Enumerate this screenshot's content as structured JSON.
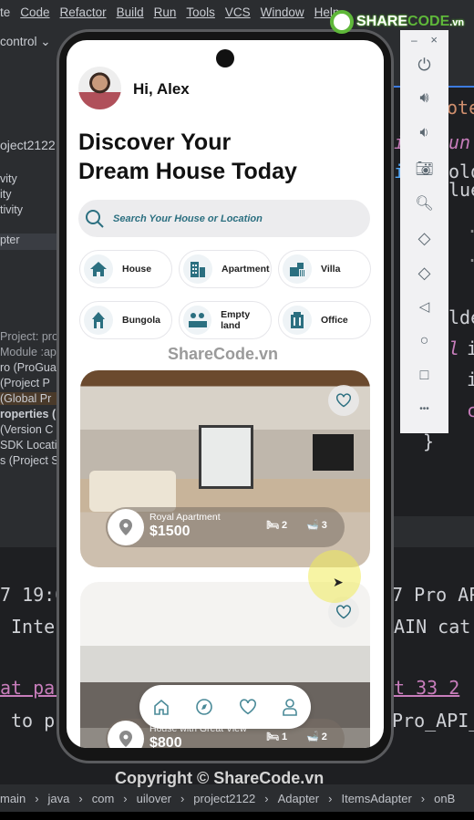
{
  "ide": {
    "menu": [
      "te",
      "Code",
      "Refactor",
      "Build",
      "Run",
      "Tools",
      "VCS",
      "Window",
      "Help"
    ],
    "run_config": "control",
    "tab_fragment": "t",
    "left_panel": [
      "oject2122",
      "vity",
      "ity",
      "tivity",
      "pter",
      "Project: pro",
      "Module :ap",
      "ro (ProGua",
      "(Project P",
      "(Global Pr",
      "roperties (",
      "(Version C",
      "SDK Locati",
      "s (Project S"
    ],
    "code_right": [
      "ote",
      "un",
      "old",
      "lue",
      ".",
      ".",
      "lde",
      "i",
      "i",
      "c",
      "}"
    ],
    "code_left_markers": [
      "i",
      "i",
      "i",
      "l"
    ],
    "log_left": [
      "7 19:0",
      "Inter",
      "at par",
      "to pr"
    ],
    "log_right": [
      "7 Pro AP",
      "AIN cat",
      "t 33 2",
      "Pro_API_"
    ],
    "breadcrumb": [
      "main",
      "java",
      "com",
      "uilover",
      "project2122",
      "Adapter",
      "ItemsAdapter",
      "onB"
    ]
  },
  "watermark": {
    "logo": "SHARECODE.vn",
    "center": "ShareCode.vn",
    "copyright": "Copyright © ShareCode.vn"
  },
  "emulator_toolbar": {
    "minimize": "–",
    "close": "×",
    "buttons": [
      "power-icon",
      "volume-up-icon",
      "volume-down-icon",
      "camera-icon",
      "zoom-icon",
      "rotate-left-icon",
      "rotate-right-icon",
      "back-icon",
      "home-icon",
      "overview-icon",
      "more-icon"
    ],
    "more": "•••"
  },
  "app": {
    "greeting": "Hi, Alex",
    "headline_1": "Discover Your",
    "headline_2": "Dream House Today",
    "search_placeholder": "Search Your House or Location",
    "categories": [
      {
        "label": "House",
        "icon": "house-icon"
      },
      {
        "label": "Apartment",
        "icon": "apartment-icon"
      },
      {
        "label": "Villa",
        "icon": "villa-icon"
      },
      {
        "label": "Bungola",
        "icon": "bungalow-icon"
      },
      {
        "label": "Empty land",
        "icon": "land-icon"
      },
      {
        "label": "Office",
        "icon": "office-icon"
      }
    ],
    "listings": [
      {
        "title": "Royal Apartment",
        "price": "$1500",
        "beds": "2",
        "baths": "3"
      },
      {
        "title": "House with Great View",
        "price": "$800",
        "beds": "1",
        "baths": "2"
      }
    ],
    "nav": [
      "home-icon",
      "explore-icon",
      "favorite-icon",
      "profile-icon"
    ],
    "accent": "#2b6f80"
  }
}
